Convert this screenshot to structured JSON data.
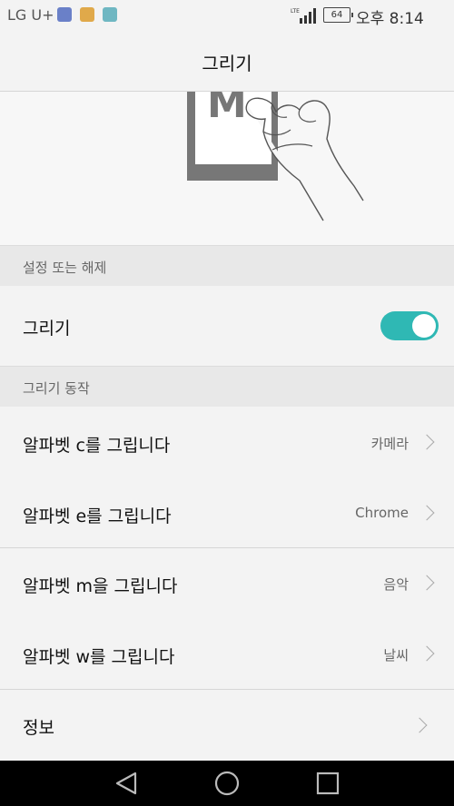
{
  "status_bar": {
    "carrier": "LG U+",
    "network": "LTE",
    "battery": "64",
    "time": "오후 8:14"
  },
  "header": {
    "title": "그리기"
  },
  "illustration": {
    "letter": "M"
  },
  "sections": [
    {
      "title": "설정 또는 해제"
    },
    {
      "title": "그리기 동작"
    }
  ],
  "toggle_row": {
    "label": "그리기",
    "enabled": true
  },
  "gesture_rows": [
    {
      "label": "알파벳 c를 그립니다",
      "value": "카메라"
    },
    {
      "label": "알파벳 e를 그립니다",
      "value": "Chrome"
    },
    {
      "label": "알파벳 m을 그립니다",
      "value": "음악"
    },
    {
      "label": "알파벳 w를 그립니다",
      "value": "날씨"
    }
  ],
  "info_row": {
    "label": "정보"
  },
  "colors": {
    "accent": "#2fb8b4",
    "background": "#f3f3f3",
    "section": "#e8e8e8"
  },
  "nav_icons": [
    "back-icon",
    "home-icon",
    "recents-icon"
  ]
}
